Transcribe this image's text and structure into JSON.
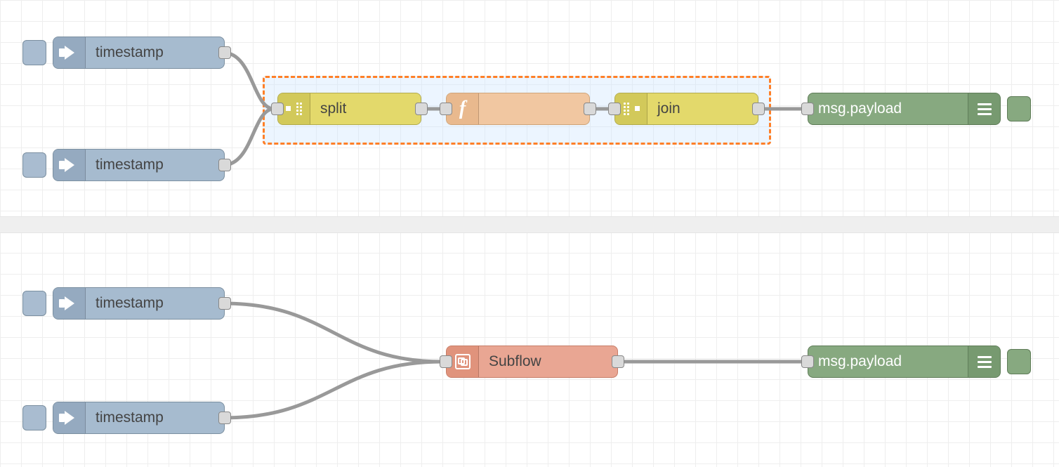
{
  "flow1": {
    "inject_a": {
      "label": "timestamp"
    },
    "inject_b": {
      "label": "timestamp"
    },
    "split": {
      "label": "split"
    },
    "function": {
      "label": ""
    },
    "join": {
      "label": "join"
    },
    "debug": {
      "label": "msg.payload"
    }
  },
  "flow2": {
    "inject_a": {
      "label": "timestamp"
    },
    "inject_b": {
      "label": "timestamp"
    },
    "subflow": {
      "label": "Subflow"
    },
    "debug": {
      "label": "msg.payload"
    }
  },
  "colors": {
    "inject": "#a6bbcf",
    "sequence": "#e3d96b",
    "function": "#f1c7a1",
    "subflow": "#e9a693",
    "debug": "#87a980",
    "selection_border": "#ff7f27"
  }
}
